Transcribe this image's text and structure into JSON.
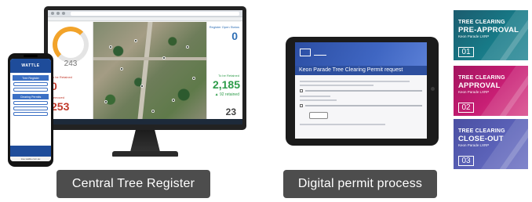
{
  "central_register": {
    "gauge_value": "243",
    "left_kpi_1": {
      "label": "To be Retained",
      "value": "0"
    },
    "left_kpi_2": {
      "label": "Removed",
      "value": "253"
    },
    "right_kpi_1": {
      "label": "Register Open Status",
      "value": "0"
    },
    "right_kpi_2": {
      "label": "To be Retained",
      "value": "2,185",
      "sub": "▲ 92 retained"
    },
    "right_kpi_3": {
      "value": "23"
    },
    "caption": "Central Tree Register"
  },
  "phone": {
    "app_name": "WATTLE",
    "sections": [
      "Tree Register",
      "Clearing Permits"
    ],
    "url": "tree.wattle.com.au"
  },
  "permit_form": {
    "title": "Keon Parade Tree Clearing Permit request",
    "caption": "Digital permit process"
  },
  "cards": [
    {
      "line1": "TREE CLEARING",
      "line2": "PRE-APPROVAL",
      "project": "Keon Parade LXRP",
      "number": "01",
      "color": "#177a87"
    },
    {
      "line1": "TREE CLEARING",
      "line2": "APPROVAL",
      "project": "Keon Parade LXRP",
      "number": "02",
      "color": "#c81e74"
    },
    {
      "line1": "TREE CLEARING",
      "line2": "CLOSE-OUT",
      "project": "Keon Parade LXRP",
      "number": "03",
      "color": "#5b62b8"
    }
  ]
}
